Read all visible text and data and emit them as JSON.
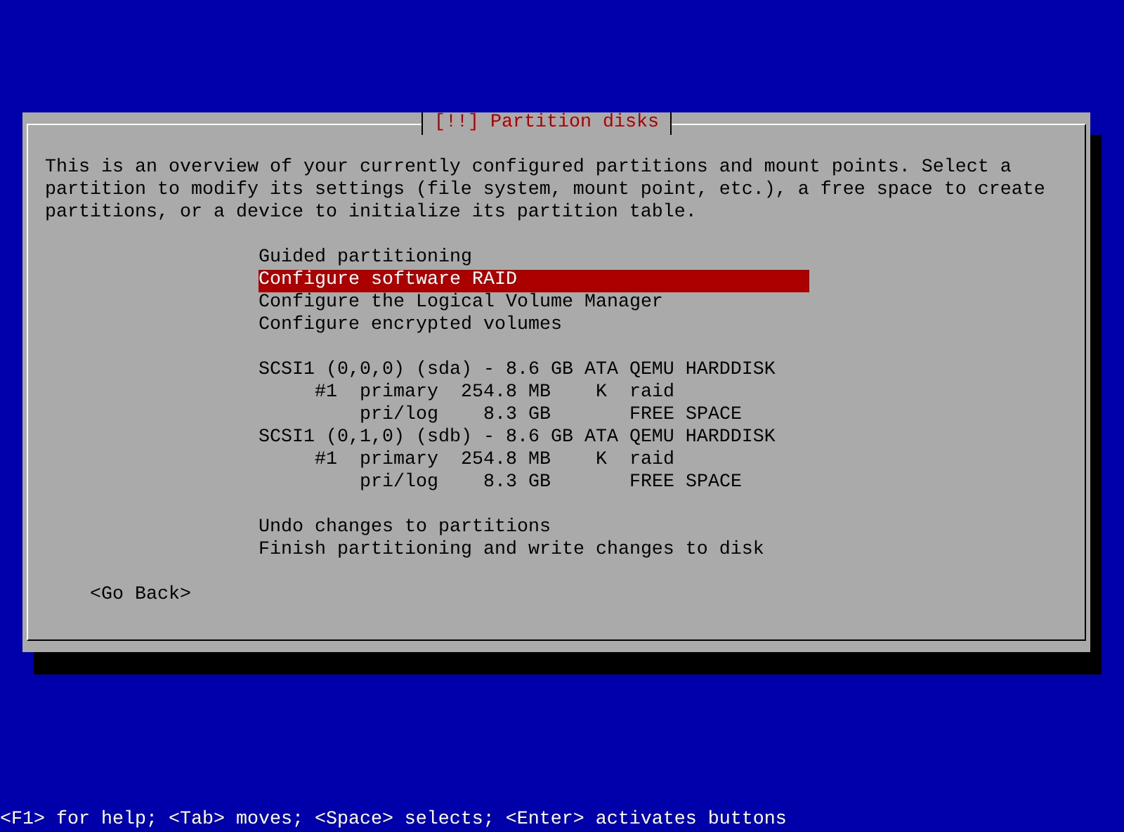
{
  "dialog": {
    "title": "[!!] Partition disks",
    "description": "This is an overview of your currently configured partitions and mount points. Select a partition to modify its settings (file system, mount point, etc.), a free space to create partitions, or a device to initialize its partition table.",
    "actions": [
      {
        "label": "Guided partitioning",
        "selected": false
      },
      {
        "label": "Configure software RAID",
        "selected": true
      },
      {
        "label": "Configure the Logical Volume Manager",
        "selected": false
      },
      {
        "label": "Configure encrypted volumes",
        "selected": false
      }
    ],
    "disks": [
      {
        "label": "SCSI1 (0,0,0) (sda) - 8.6 GB ATA QEMU HARDDISK",
        "selected": false,
        "partitions": [
          {
            "number": "#1",
            "type": "primary",
            "size": "254.8 MB",
            "flag": "K",
            "usage": "raid",
            "selected": false
          },
          {
            "type": "pri/log",
            "size": "8.3 GB",
            "usage": "FREE SPACE",
            "selected": false
          }
        ]
      },
      {
        "label": "SCSI1 (0,1,0) (sdb) - 8.6 GB ATA QEMU HARDDISK",
        "selected": false,
        "partitions": [
          {
            "number": "#1",
            "type": "primary",
            "size": "254.8 MB",
            "flag": "K",
            "usage": "raid",
            "selected": false
          },
          {
            "type": "pri/log",
            "size": "8.3 GB",
            "usage": "FREE SPACE",
            "selected": false
          }
        ]
      }
    ],
    "final_actions": [
      {
        "label": "Undo changes to partitions",
        "selected": false
      },
      {
        "label": "Finish partitioning and write changes to disk",
        "selected": false
      }
    ],
    "back_button": "<Go Back>"
  },
  "help_line": "<F1> for help; <Tab> moves; <Space> selects; <Enter> activates buttons"
}
